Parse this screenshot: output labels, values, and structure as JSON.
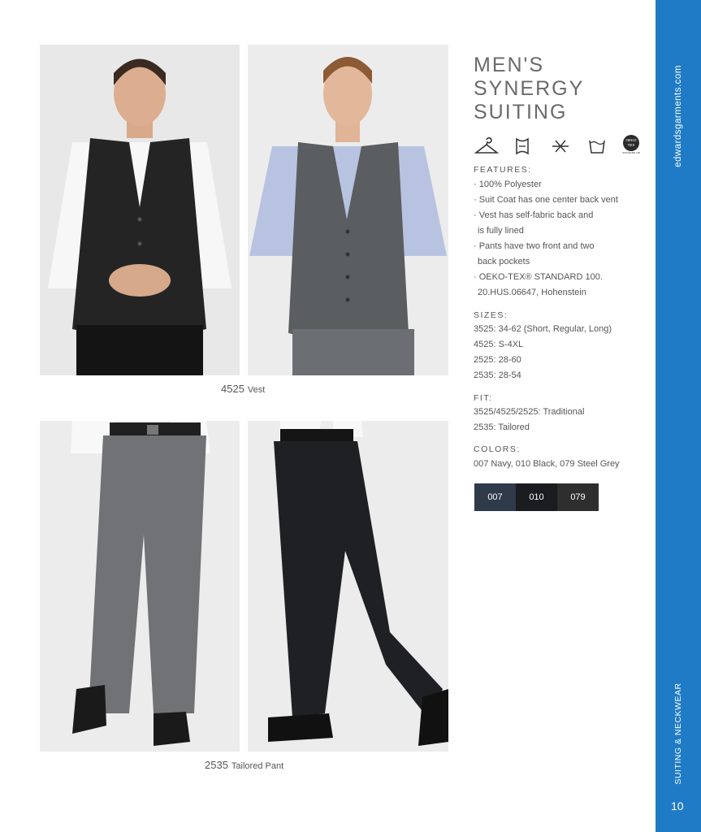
{
  "product_title": [
    "MEN'S",
    "SYNERGY",
    "SUITING"
  ],
  "care_icons": [
    "hanger-icon",
    "pressing-icon",
    "do-not-iron-icon",
    "wash-icon",
    "oeko-tex-badge-icon"
  ],
  "oeko_badge": {
    "top": "OEKO",
    "mid": "TEX",
    "bottom": "STANDARD 100"
  },
  "features": {
    "heading": "FEATURES:",
    "lines": [
      "· 100% Polyester",
      "· Suit Coat has one center back vent",
      "· Vest has self-fabric back and",
      "is fully lined",
      "· Pants have two front and two",
      "back pockets",
      "· OEKO-TEX® STANDARD 100.",
      "20.HUS.06647, Hohenstein"
    ]
  },
  "sizes": {
    "heading": "SIZES:",
    "lines": [
      "3525: 34-62 (Short, Regular, Long)",
      "4525: S-4XL",
      "2525: 28-60",
      "2535: 28-54"
    ]
  },
  "fit": {
    "heading": "FIT:",
    "lines": [
      "3525/4525/2525: Traditional",
      "2535: Tailored"
    ]
  },
  "colors": {
    "heading": "COLORS:",
    "line": "007 Navy, 010 Black, 079 Steel Grey",
    "swatches": [
      {
        "code": "007",
        "color": "#2f3a4b"
      },
      {
        "code": "010",
        "color": "#1b1c1f"
      },
      {
        "code": "079",
        "color": "#2e2e2e"
      }
    ]
  },
  "captions": {
    "vest": {
      "code": "4525",
      "label": "Vest"
    },
    "pant": {
      "code": "2535",
      "label": "Tailored Pant"
    }
  },
  "sidebar": {
    "url": "edwardsgarments.com",
    "section": "SUITING & NECKWEAR",
    "page_number": "10",
    "color": "#1f7bc6"
  }
}
